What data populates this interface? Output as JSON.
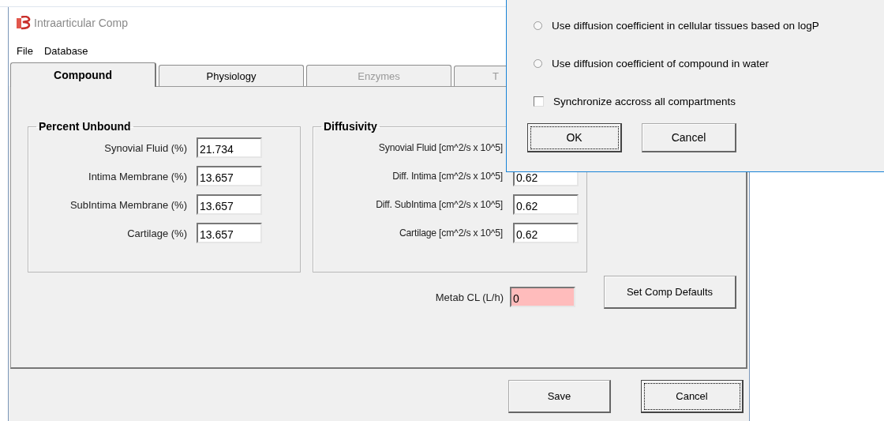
{
  "window": {
    "title": "Intraarticular Comp"
  },
  "menu": [
    {
      "label": "File"
    },
    {
      "label": "Database"
    }
  ],
  "tabs": [
    {
      "label": "Compound",
      "selected": true,
      "disabled": false
    },
    {
      "label": "Physiology",
      "selected": false,
      "disabled": false
    },
    {
      "label": "Enzymes",
      "selected": false,
      "disabled": true
    },
    {
      "label": "T",
      "selected": false,
      "disabled": true
    }
  ],
  "percent_unbound": {
    "title": "Percent Unbound",
    "fields": [
      {
        "label": "Synovial Fluid (%)",
        "value": "21.734"
      },
      {
        "label": "Intima Membrane (%)",
        "value": "13.657"
      },
      {
        "label": "SubIntima Membrane (%)",
        "value": "13.657"
      },
      {
        "label": "Cartilage (%)",
        "value": "13.657"
      }
    ]
  },
  "diffusivity": {
    "title": "Diffusivity",
    "fields": [
      {
        "label": "Synovial Fluid [cm^2/s x 10^5]"
      },
      {
        "label": "Diff. Intima [cm^2/s x 10^5]",
        "value": "0.62"
      },
      {
        "label": "Diff. SubIntima [cm^2/s x 10^5]",
        "value": "0.62"
      },
      {
        "label": "Cartilage [cm^2/s x 10^5]",
        "value": "0.62"
      }
    ]
  },
  "metab_cl": {
    "label": "Metab CL (L/h)",
    "value": "0",
    "invalid": true
  },
  "set_defaults_button": "Set Comp Defaults",
  "footer_buttons": [
    {
      "label": "Save",
      "focused": false
    },
    {
      "label": "Cancel",
      "focused": true
    }
  ],
  "dialog": {
    "options": [
      {
        "kind": "radio",
        "label": "Use diffusion coefficient in cellular tissues based on logP",
        "selected": false
      },
      {
        "kind": "radio",
        "label": "Use diffusion coefficient of compound in water",
        "selected": false
      },
      {
        "kind": "checkbox",
        "label": "Synchronize accross all compartments",
        "checked": false
      }
    ],
    "buttons": [
      {
        "label": "OK",
        "focused": true
      },
      {
        "label": "Cancel",
        "focused": false
      }
    ]
  }
}
